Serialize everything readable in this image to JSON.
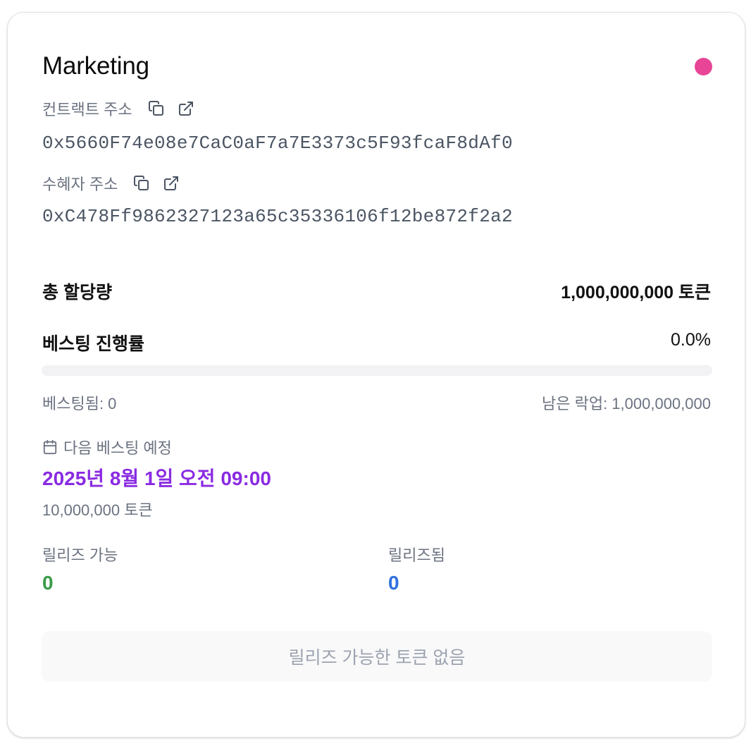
{
  "card": {
    "title": "Marketing",
    "status_color": "#e84597"
  },
  "contract": {
    "label": "컨트랙트 주소",
    "address": "0x5660F74e08e7CaC0aF7a7E3373c5F93fcaF8dAf0",
    "copy_icon": "copy-icon",
    "open_icon": "external-link-icon"
  },
  "beneficiary": {
    "label": "수혜자 주소",
    "address": "0xC478Ff9862327123a65c35336106f12be872f2a2",
    "copy_icon": "copy-icon",
    "open_icon": "external-link-icon"
  },
  "allocation": {
    "label": "총 할당량",
    "value": "1,000,000,000 토큰"
  },
  "vesting": {
    "label": "베스팅 진행률",
    "percent_text": "0.0%",
    "progress": 0.0,
    "vested_text": "베스팅됨: 0",
    "locked_text": "남은 락업: 1,000,000,000"
  },
  "next_vesting": {
    "icon": "calendar-icon",
    "label": "다음 베스팅 예정",
    "date": "2025년 8월 1일 오전 09:00",
    "amount": "10,000,000 토큰"
  },
  "releasable": {
    "label": "릴리즈 가능",
    "value": "0",
    "color": "#3a9a48"
  },
  "released": {
    "label": "릴리즈됨",
    "value": "0",
    "color": "#2f6fe0"
  },
  "release_button": {
    "label": "릴리즈 가능한 토큰 없음"
  }
}
